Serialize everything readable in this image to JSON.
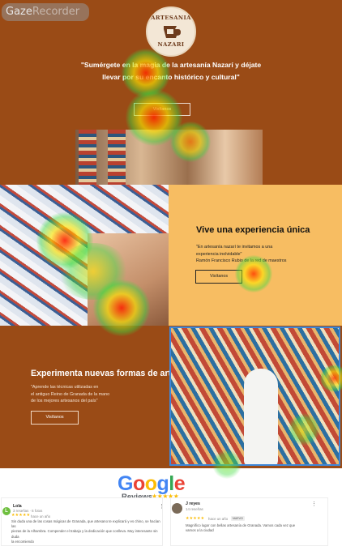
{
  "recorder": {
    "part1": "Gaze",
    "part2": "Recorder"
  },
  "logo": {
    "top": "ARTESANIA",
    "bottom": "NAZARI",
    "mark": "ceramic-jug-icon"
  },
  "hero": {
    "tagline_line1": "\"Sumérgete en la magia de la artesanía Nazarí y déjate",
    "tagline_line2": "llevar por su encanto histórico y cultural\"",
    "button": "Visítanos"
  },
  "section2": {
    "heading": "Vive una experiencia única",
    "quote_line1": "\"En artesanía nazarí te invitamos a una",
    "quote_line2": "experiencia inolvidable\"",
    "quote_line3": "Ramón Francisco Rubio de la red de maestros",
    "button": "Visítanos"
  },
  "section3": {
    "heading": "Experimenta nuevas formas de arte",
    "quote_line1": "\"Aprende las técnicas utilizadas en",
    "quote_line2": "el antiguo Reino de Granada de la mano",
    "quote_line3": "de los mejores artesanos del país\"",
    "button": "Visítanos"
  },
  "google": {
    "letters": [
      "G",
      "o",
      "o",
      "g",
      "l",
      "e"
    ],
    "reviews_label": "Reviews",
    "stars": "★★★★★"
  },
  "reviews": [
    {
      "avatar_letter": "L",
      "name": "Lola",
      "meta": "3 reseñas · 6 fotos",
      "stars": "★★★★★",
      "time": "hace un año",
      "text_line1": "Sin duda una de las cosas mágicas de Granada, que artesano te explicará y es chino, se hacían las",
      "text_line2": "piezas de la Alhambra. Compender el trabajo y la dedicación que conlleva. Muy interesante sin duda",
      "text_line3": "la encomiendo"
    },
    {
      "avatar_letter": "",
      "name": "J reyes",
      "meta": "14 reseñas",
      "stars": "★★★★★",
      "time": "hace un año",
      "badge": "NUEVO",
      "text_line1": "Magnífico lugar con bellas artesanía de Granada. Vamos cada vez que",
      "text_line2": "vamos a la ciudad"
    }
  ]
}
